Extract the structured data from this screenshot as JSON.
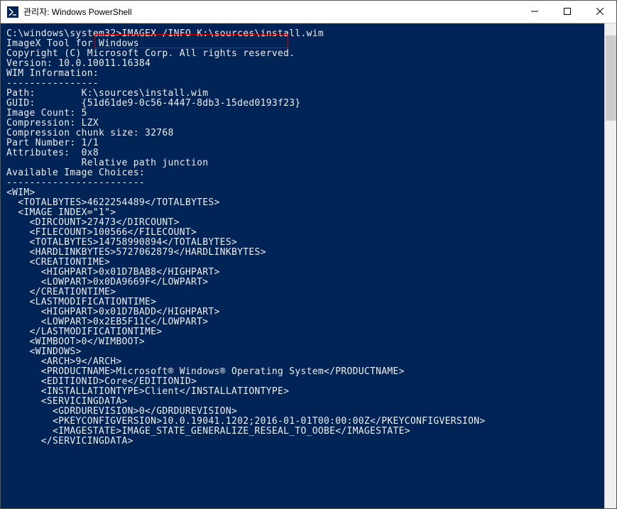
{
  "window": {
    "title": "관리자: Windows PowerShell"
  },
  "terminal": {
    "blank1": "",
    "prompt": "C:\\windows\\system32>",
    "command": "IMAGEX /INFO K:\\sources\\install.wim",
    "blank2": "",
    "line_tool": "ImageX Tool for Windows",
    "line_copyright": "Copyright (C) Microsoft Corp. All rights reserved.",
    "line_version": "Version: 10.0.10011.16384",
    "blank3": "",
    "line_wiminfo": "WIM Information:",
    "line_dash1": "----------------",
    "line_path": "Path:        K:\\sources\\install.wim",
    "line_guid": "GUID:        {51d61de9-0c56-4447-8db3-15ded0193f23}",
    "line_imgcount": "Image Count: 5",
    "line_compression": "Compression: LZX",
    "line_chunksize": "Compression chunk size: 32768",
    "line_partnum": "Part Number: 1/1",
    "line_attrs": "Attributes:  0x8",
    "line_reljunc": "             Relative path junction",
    "blank4": "",
    "blank5": "",
    "line_avail": "Available Image Choices:",
    "line_dash2": "------------------------",
    "xml_wim": "<WIM>",
    "xml_totalbytes": "  <TOTALBYTES>4622254489</TOTALBYTES>",
    "xml_imageidx": "  <IMAGE INDEX=\"1\">",
    "xml_dircount": "    <DIRCOUNT>27473</DIRCOUNT>",
    "xml_filecount": "    <FILECOUNT>100566</FILECOUNT>",
    "xml_totalbytes2": "    <TOTALBYTES>14758990894</TOTALBYTES>",
    "xml_hardlink": "    <HARDLINKBYTES>5727062879</HARDLINKBYTES>",
    "xml_ctime_open": "    <CREATIONTIME>",
    "xml_ctime_high": "      <HIGHPART>0x01D7BAB8</HIGHPART>",
    "xml_ctime_low": "      <LOWPART>0x0DA9669F</LOWPART>",
    "xml_ctime_close": "    </CREATIONTIME>",
    "xml_mtime_open": "    <LASTMODIFICATIONTIME>",
    "xml_mtime_high": "      <HIGHPART>0x01D7BADD</HIGHPART>",
    "xml_mtime_low": "      <LOWPART>0x2EB5F11C</LOWPART>",
    "xml_mtime_close": "    </LASTMODIFICATIONTIME>",
    "xml_wimboot": "    <WIMBOOT>0</WIMBOOT>",
    "xml_windows_open": "    <WINDOWS>",
    "xml_arch": "      <ARCH>9</ARCH>",
    "xml_product": "      <PRODUCTNAME>Microsoft® Windows® Operating System</PRODUCTNAME>",
    "xml_edition": "      <EDITIONID>Core</EDITIONID>",
    "xml_installtype": "      <INSTALLATIONTYPE>Client</INSTALLATIONTYPE>",
    "xml_svcdata_open": "      <SERVICINGDATA>",
    "xml_gdrdu": "        <GDRDUREVISION>0</GDRDUREVISION>",
    "xml_pkeyconfig": "        <PKEYCONFIGVERSION>10.0.19041.1202;2016-01-01T00:00:00Z</PKEYCONFIGVERSION>",
    "xml_imagestate": "        <IMAGESTATE>IMAGE_STATE_GENERALIZE_RESEAL_TO_OOBE</IMAGESTATE>",
    "xml_svcdata_close": "      </SERVICINGDATA>"
  }
}
